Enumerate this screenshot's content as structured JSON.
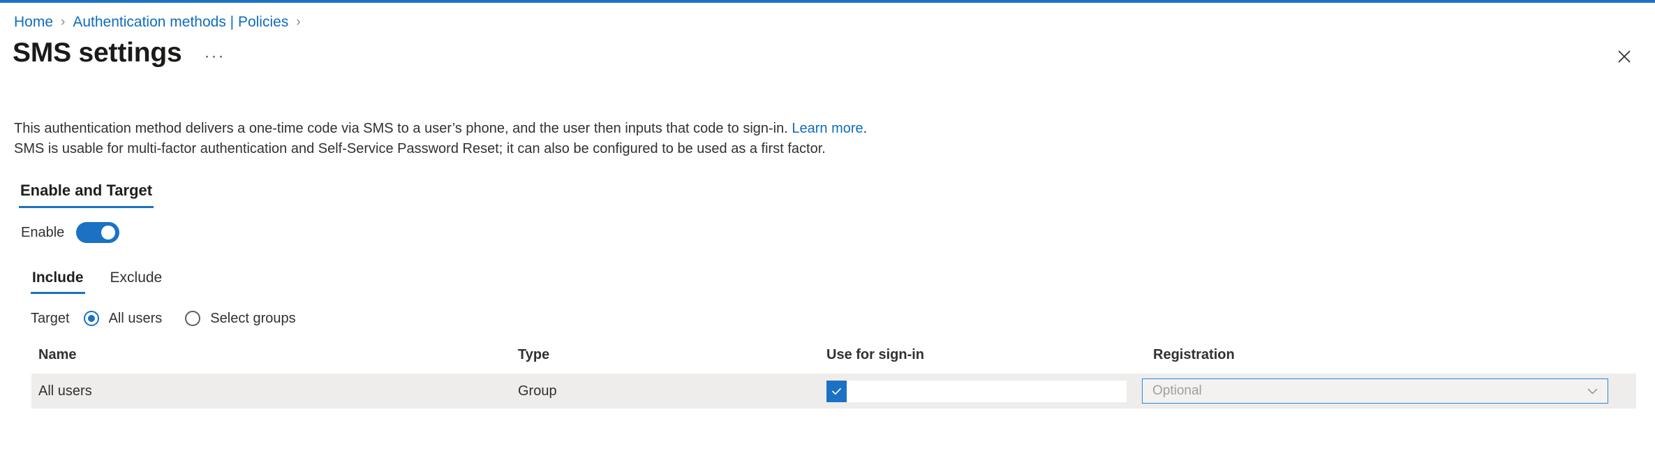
{
  "theme": {
    "accent": "#1b72c4",
    "link": "#0f6cbd",
    "row_background": "#eeedec",
    "placeholder_text": "#a19f9d",
    "dropdown_border": "#2b88d8"
  },
  "breadcrumb": {
    "items": [
      {
        "label": "Home"
      },
      {
        "label": "Authentication methods | Policies"
      }
    ],
    "separator": "›"
  },
  "header": {
    "title": "SMS settings",
    "more_actions_label": "···",
    "close_icon": "close-icon"
  },
  "description": {
    "line1_text": "This authentication method delivers a one-time code via SMS to a user’s phone, and the user then inputs that code to sign-in. ",
    "link_text": "Learn more",
    "line1_suffix": ".",
    "line2": "SMS is usable for multi-factor authentication and Self-Service Password Reset; it can also be configured to be used as a first factor."
  },
  "pivot_primary": {
    "tabs": [
      {
        "label": "Enable and Target",
        "active": true
      }
    ]
  },
  "enable": {
    "label": "Enable",
    "toggle_state": "on"
  },
  "pivot_secondary": {
    "tabs": [
      {
        "label": "Include",
        "active": true
      },
      {
        "label": "Exclude",
        "active": false
      }
    ]
  },
  "target": {
    "label": "Target",
    "options": [
      {
        "label": "All users",
        "selected": true
      },
      {
        "label": "Select groups",
        "selected": false
      }
    ]
  },
  "table": {
    "columns": [
      {
        "key": "name",
        "header": "Name"
      },
      {
        "key": "type",
        "header": "Type"
      },
      {
        "key": "signin",
        "header": "Use for sign-in"
      },
      {
        "key": "registration",
        "header": "Registration"
      }
    ],
    "rows": [
      {
        "name": "All users",
        "type": "Group",
        "signin_checked": true,
        "registration_placeholder": "Optional",
        "registration_value": ""
      }
    ]
  }
}
